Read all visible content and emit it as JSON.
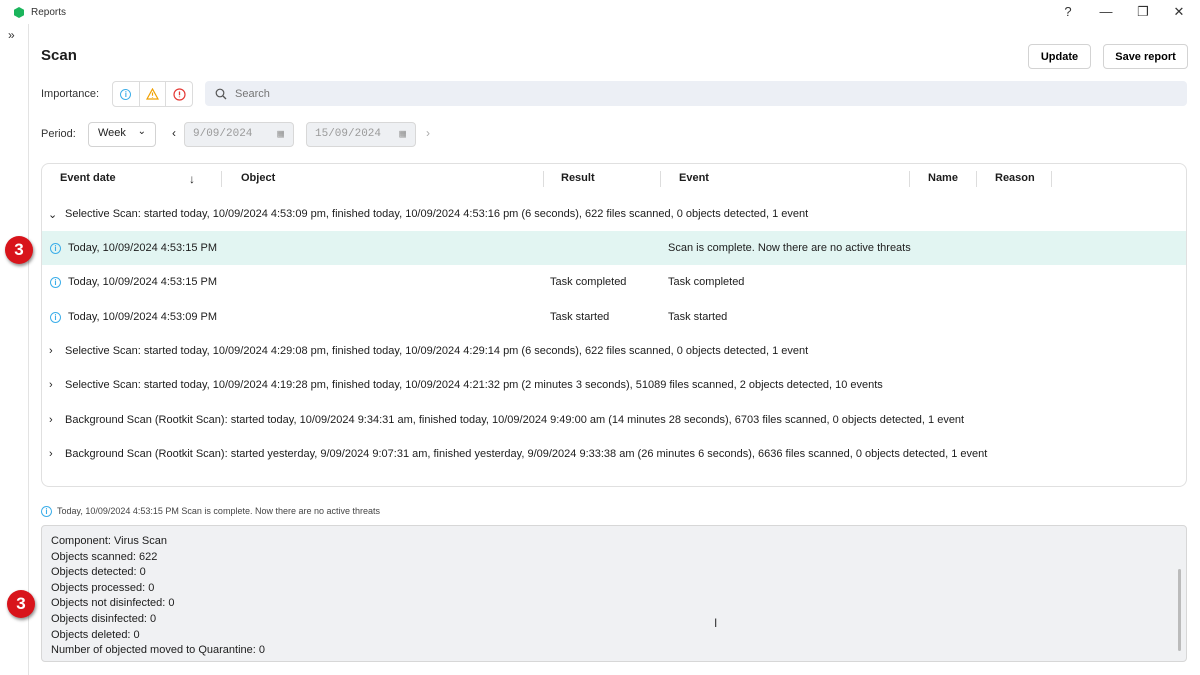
{
  "app": {
    "title": "Reports",
    "window_buttons": [
      "?",
      "—",
      "❐",
      "✕"
    ]
  },
  "page": {
    "title": "Scan",
    "update_label": "Update",
    "save_label": "Save report"
  },
  "filters": {
    "importance_label": "Importance:",
    "search_placeholder": "Search",
    "period_label": "Period:",
    "period_value": "Week",
    "date_from": "9/09/2024",
    "date_to": "15/09/2024"
  },
  "table": {
    "columns": [
      "Event date",
      "Object",
      "Result",
      "Event",
      "Name",
      "Reason"
    ],
    "groups": [
      {
        "text": "Selective Scan: started today, 10/09/2024 4:53:09 pm, finished today, 10/09/2024 4:53:16 pm (6 seconds), 622 files scanned, 0 objects detected, 1 event",
        "expanded": true,
        "rows": [
          {
            "date": "Today, 10/09/2024 4:53:15 PM",
            "result": "",
            "event": "Scan is complete. Now there are no active threats",
            "selected": true
          },
          {
            "date": "Today, 10/09/2024 4:53:15 PM",
            "result": "Task completed",
            "event": "Task completed"
          },
          {
            "date": "Today, 10/09/2024 4:53:09 PM",
            "result": "Task started",
            "event": "Task started"
          }
        ]
      },
      {
        "text": "Selective Scan: started today, 10/09/2024 4:29:08 pm, finished today, 10/09/2024 4:29:14 pm (6 seconds), 622 files scanned, 0 objects detected, 1 event"
      },
      {
        "text": "Selective Scan: started today, 10/09/2024 4:19:28 pm, finished today, 10/09/2024 4:21:32 pm (2 minutes 3 seconds), 51089 files scanned, 2 objects detected, 10 events"
      },
      {
        "text": "Background Scan (Rootkit Scan): started today, 10/09/2024 9:34:31 am, finished today, 10/09/2024 9:49:00 am (14 minutes 28 seconds), 6703 files scanned, 0 objects detected, 1 event"
      },
      {
        "text": "Background Scan (Rootkit Scan): started yesterday, 9/09/2024 9:07:31 am, finished yesterday, 9/09/2024 9:33:38 am (26 minutes 6 seconds), 6636 files scanned, 0 objects detected, 1 event"
      }
    ]
  },
  "details": {
    "summary": "Today, 10/09/2024 4:53:15 PM Scan is complete. Now there are no active threats",
    "lines": [
      "Component: Virus Scan",
      "Objects scanned: 622",
      "Objects detected: 0",
      "Objects processed: 0",
      "Objects not disinfected: 0",
      "Objects disinfected: 0",
      "Objects deleted: 0",
      "Number of objected moved to Quarantine: 0"
    ]
  },
  "annotations": {
    "badge1": "3",
    "badge2": "3"
  },
  "colors": {
    "accent": "#1bb55c",
    "selected_row": "#e2f5f2",
    "badge": "#d8141b"
  }
}
